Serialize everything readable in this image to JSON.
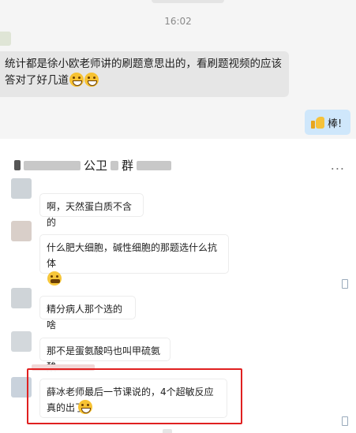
{
  "top_chat": {
    "timestamp": "16:02",
    "left_message": "统计都是徐小欧老师讲的刷题意思出的，看刷题视频的应该答对了好几道",
    "left_message_emojis": [
      "grin-emoji",
      "grin-emoji"
    ],
    "right_message": "棒!",
    "right_message_icon": "thumbs-up-emoji"
  },
  "group_chat": {
    "title_visible": "公卫",
    "title_suffix_visible": "群",
    "more_label": "...",
    "messages": [
      {
        "text": "啊，天然蛋白质不含的"
      },
      {
        "text": "什么肥大细胞，碱性细胞的那题选什么抗体",
        "emoji": "sweat-emoji"
      },
      {
        "text": "精分病人那个选的啥"
      },
      {
        "text": "那不是蛋氨酸吗也叫甲硫氨酸"
      },
      {
        "text": "薛冰老师最后一节课说的，4个超敏反应真的出了",
        "emoji": "grin-emoji",
        "highlighted": true
      }
    ]
  },
  "colors": {
    "right_bubble": "#cfe7fb",
    "left_bubble_top": "#e6e6e6",
    "highlight_border": "#e02020"
  }
}
